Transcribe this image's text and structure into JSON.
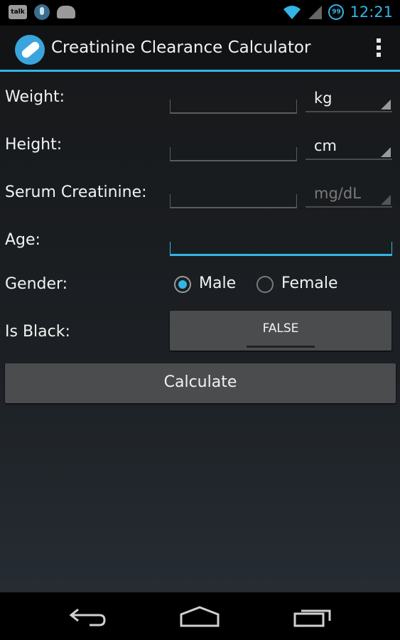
{
  "status_bar": {
    "notification_icons": [
      "talk-icon",
      "voice-search-icon",
      "android-icon"
    ],
    "talk_text": "talk",
    "sync_text": "99",
    "time": "12:21",
    "accent_color": "#33b5e5"
  },
  "action_bar": {
    "title": "Creatinine Clearance Calculator",
    "app_icon": "pill-icon",
    "menu_icon": "overflow-menu-icon"
  },
  "form": {
    "weight": {
      "label": "Weight:",
      "value": "",
      "unit": "kg"
    },
    "height": {
      "label": "Height:",
      "value": "",
      "unit": "cm"
    },
    "serum_creatinine": {
      "label": "Serum Creatinine:",
      "value": "",
      "unit": "mg/dL"
    },
    "age": {
      "label": "Age:",
      "value": ""
    },
    "gender": {
      "label": "Gender:",
      "options": [
        "Male",
        "Female"
      ],
      "selected": "Male"
    },
    "is_black": {
      "label": "Is Black:",
      "value": "FALSE"
    }
  },
  "calculate_label": "Calculate",
  "nav_bar": {
    "icons": [
      "back-icon",
      "home-icon",
      "recents-icon"
    ]
  }
}
